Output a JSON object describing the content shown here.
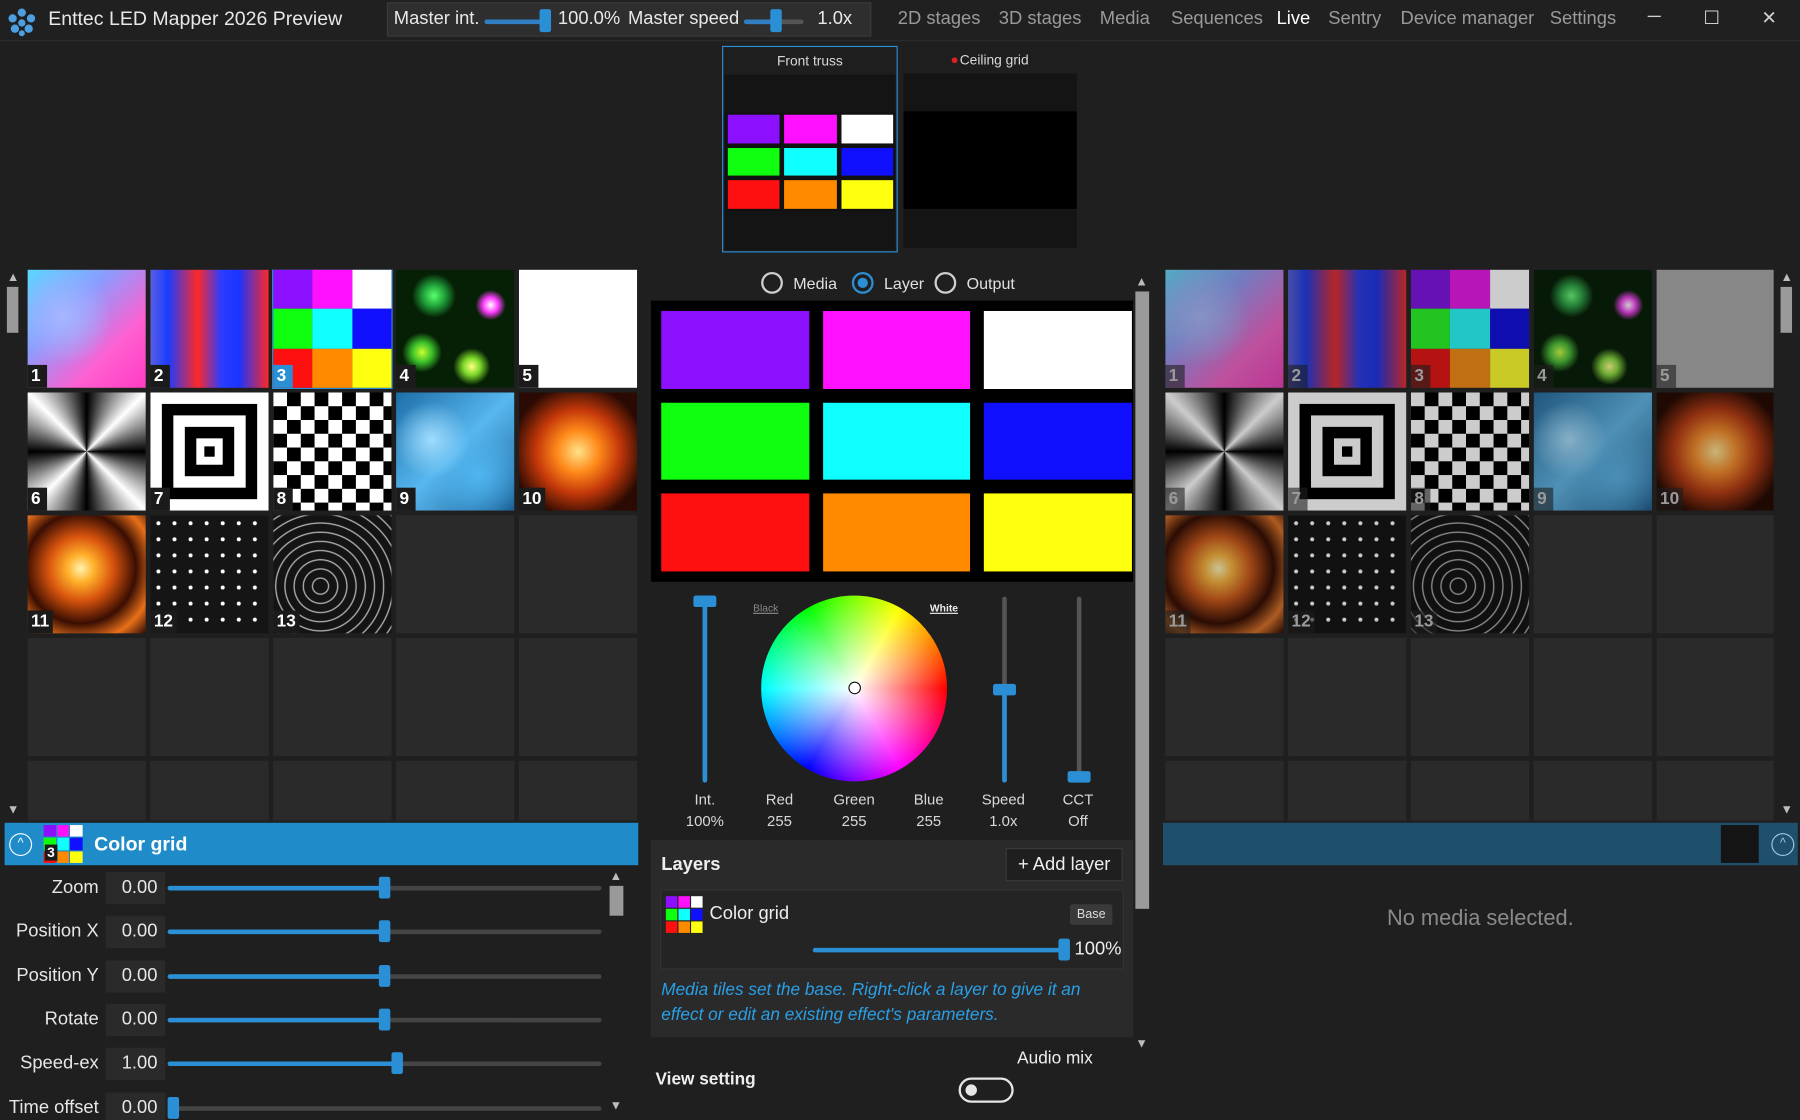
{
  "app": {
    "title": "Enttec LED Mapper 2026 Preview"
  },
  "master": {
    "intensity_label": "Master int.",
    "intensity_value": "100.0%",
    "intensity_level": 1.0,
    "speed_label": "Master speed",
    "speed_value": "1.0x",
    "speed_level": 0.5
  },
  "nav": {
    "items": [
      "2D stages",
      "3D stages",
      "Media",
      "Sequences",
      "Live",
      "Sentry",
      "Device manager",
      "Settings"
    ],
    "active": "Live"
  },
  "window": {
    "minimize": "─",
    "maximize": "☐",
    "close": "✕"
  },
  "stages": [
    {
      "name": "Front truss",
      "selected": true,
      "indicator": false
    },
    {
      "name": "Ceiling grid",
      "selected": false,
      "indicator": true,
      "indicator_color": "#e02020"
    }
  ],
  "grid_colors": [
    "#8c0fff",
    "#ff10ff",
    "#ffffff",
    "#10ff10",
    "#10ffff",
    "#1010ff",
    "#ff1010",
    "#ff8a00",
    "#ffff10"
  ],
  "media_tiles": [
    {
      "number": "1",
      "name": "pastel-gradient"
    },
    {
      "number": "2",
      "name": "blue-red-stripes"
    },
    {
      "number": "3",
      "name": "color-grid",
      "selected": true
    },
    {
      "number": "4",
      "name": "glowing-orbs"
    },
    {
      "number": "5",
      "name": "white"
    },
    {
      "number": "6",
      "name": "radial-sunburst"
    },
    {
      "number": "7",
      "name": "concentric-squares"
    },
    {
      "number": "8",
      "name": "diamond-pattern"
    },
    {
      "number": "9",
      "name": "water-caustics"
    },
    {
      "number": "10",
      "name": "fire-explosion"
    },
    {
      "number": "11",
      "name": "fire-spiral"
    },
    {
      "number": "12",
      "name": "particles"
    },
    {
      "number": "13",
      "name": "light-streaks"
    }
  ],
  "view_mode": {
    "options": [
      "Media",
      "Layer",
      "Output"
    ],
    "selected": "Layer"
  },
  "color": {
    "black_label": "Black",
    "white_label": "White",
    "controls": [
      {
        "label": "Int.",
        "value": "100%",
        "level": 1.0
      },
      {
        "label": "Red",
        "value": "255"
      },
      {
        "label": "Green",
        "value": "255"
      },
      {
        "label": "Blue",
        "value": "255"
      },
      {
        "label": "Speed",
        "value": "1.0x",
        "level": 0.5
      },
      {
        "label": "CCT",
        "value": "Off",
        "level": 0.0
      }
    ]
  },
  "layers": {
    "title": "Layers",
    "add_label": "+ Add layer",
    "items": [
      {
        "name": "Color grid",
        "badge": "Base",
        "opacity": "100%",
        "level": 1.0
      }
    ],
    "hint": "Media tiles set the base. Right-click a layer to give it an effect or edit an existing effect's parameters."
  },
  "view_setting": {
    "label": "View setting",
    "audio_label": "Audio mix",
    "audio_on": false
  },
  "media_panel": {
    "number": "3",
    "title": "Color grid",
    "params": [
      {
        "label": "Zoom",
        "value": "0.00",
        "level": 0.5
      },
      {
        "label": "Position X",
        "value": "0.00",
        "level": 0.5
      },
      {
        "label": "Position Y",
        "value": "0.00",
        "level": 0.5
      },
      {
        "label": "Rotate",
        "value": "0.00",
        "level": 0.5
      },
      {
        "label": "Speed-ex",
        "value": "1.00",
        "level": 0.53
      },
      {
        "label": "Time offset",
        "value": "0.00",
        "level": 0.0
      }
    ]
  },
  "right_panel": {
    "empty_message": "No media selected."
  },
  "theme": {
    "accent": "#2b8fd6",
    "header": "#1f8bc8"
  }
}
